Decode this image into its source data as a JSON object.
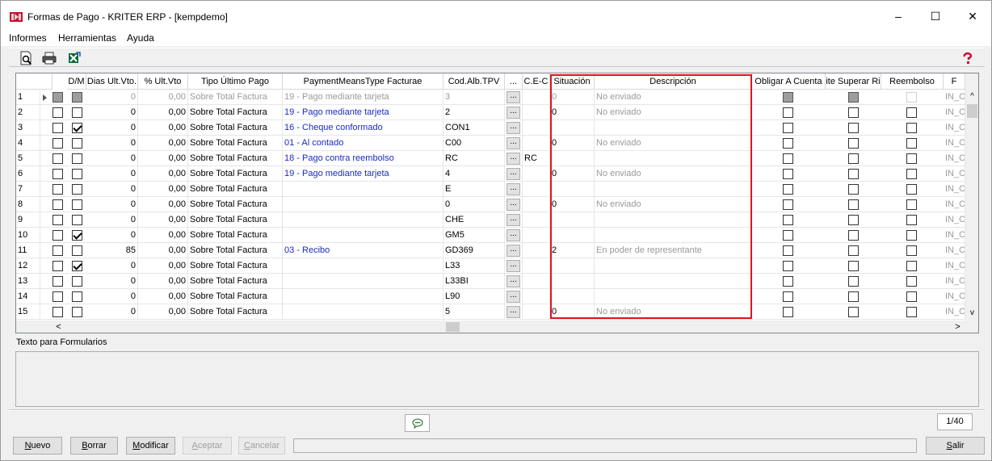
{
  "window": {
    "title": "Formas de Pago - KRITER ERP - [kempdemo]",
    "minimize": "–",
    "maximize": "☐",
    "close": "✕"
  },
  "menu": [
    "Informes",
    "Herramientas",
    "Ayuda"
  ],
  "toolbar": {
    "icons": [
      "print-preview-icon",
      "printer-icon",
      "excel-export-icon",
      "help-icon"
    ]
  },
  "grid": {
    "columns": [
      "",
      "",
      "D/M",
      "Dias Ult.Vto.",
      "% Ult.Vto",
      "Tipo Último Pago",
      "PaymentMeansType Facturae",
      "Cod.Alb.TPV",
      "...",
      "C.E-C",
      "Situación",
      "Descripción",
      "Obligar A Cuenta",
      "ite Superar Ri",
      "Reembolso",
      "F"
    ],
    "rows": [
      {
        "n": "1",
        "cur": true,
        "dm": "ind",
        "dias": "0",
        "pct": "0,00",
        "tipo": "Sobre Total Factura",
        "pm": "19 - Pago mediante tarjeta",
        "cod": "3",
        "cec": "",
        "sit": "0",
        "desc": "No enviado",
        "obl": "ind",
        "sup": "ind",
        "ree": "dis",
        "f": "IN_C",
        "gray": true
      },
      {
        "n": "2",
        "dm": "",
        "dias": "0",
        "pct": "0,00",
        "tipo": "Sobre Total Factura",
        "pm": "19 - Pago mediante tarjeta",
        "cod": "2",
        "cec": "",
        "sit": "0",
        "desc": "No enviado",
        "f": "IN_C"
      },
      {
        "n": "3",
        "dm": "chk",
        "dias": "0",
        "pct": "0,00",
        "tipo": "Sobre Total Factura",
        "pm": "16 - Cheque conformado",
        "cod": "CON1",
        "cec": "",
        "sit": "",
        "desc": "",
        "f": "IN_C"
      },
      {
        "n": "4",
        "dm": "",
        "dias": "0",
        "pct": "0,00",
        "tipo": "Sobre Total Factura",
        "pm": "01 - Al contado",
        "cod": "C00",
        "cec": "",
        "sit": "0",
        "desc": "No enviado",
        "f": "IN_C"
      },
      {
        "n": "5",
        "dm": "",
        "dias": "0",
        "pct": "0,00",
        "tipo": "Sobre Total Factura",
        "pm": "18 - Pago contra reembolso",
        "cod": "RC",
        "cec": "RC",
        "sit": "",
        "desc": "",
        "f": "IN_C"
      },
      {
        "n": "6",
        "dm": "",
        "dias": "0",
        "pct": "0,00",
        "tipo": "Sobre Total Factura",
        "pm": "19 - Pago mediante tarjeta",
        "cod": "4",
        "cec": "",
        "sit": "0",
        "desc": "No enviado",
        "f": "IN_C"
      },
      {
        "n": "7",
        "dm": "",
        "dias": "0",
        "pct": "0,00",
        "tipo": "Sobre Total Factura",
        "pm": "",
        "cod": "E",
        "cec": "",
        "sit": "",
        "desc": "",
        "f": "IN_C"
      },
      {
        "n": "8",
        "dm": "",
        "dias": "0",
        "pct": "0,00",
        "tipo": "Sobre Total Factura",
        "pm": "",
        "cod": "0",
        "cec": "",
        "sit": "0",
        "desc": "No enviado",
        "f": "IN_C"
      },
      {
        "n": "9",
        "dm": "",
        "dias": "0",
        "pct": "0,00",
        "tipo": "Sobre Total Factura",
        "pm": "",
        "cod": "CHE",
        "cec": "",
        "sit": "",
        "desc": "",
        "f": "IN_C"
      },
      {
        "n": "10",
        "dm": "chk",
        "dias": "0",
        "pct": "0,00",
        "tipo": "Sobre Total Factura",
        "pm": "",
        "cod": "GM5",
        "cec": "",
        "sit": "",
        "desc": "",
        "f": "IN_C"
      },
      {
        "n": "11",
        "dm": "",
        "dias": "85",
        "pct": "0,00",
        "tipo": "Sobre Total Factura",
        "pm": "03 - Recibo",
        "cod": "GD369",
        "cec": "",
        "sit": "2",
        "desc": "En poder de representante",
        "f": "IN_C"
      },
      {
        "n": "12",
        "dm": "chk",
        "dias": "0",
        "pct": "0,00",
        "tipo": "Sobre Total Factura",
        "pm": "",
        "cod": "L33",
        "cec": "",
        "sit": "",
        "desc": "",
        "f": "IN_C"
      },
      {
        "n": "13",
        "dm": "",
        "dias": "0",
        "pct": "0,00",
        "tipo": "Sobre Total Factura",
        "pm": "",
        "cod": "L33BI",
        "cec": "",
        "sit": "",
        "desc": "",
        "f": "IN_C"
      },
      {
        "n": "14",
        "dm": "",
        "dias": "0",
        "pct": "0,00",
        "tipo": "Sobre Total Factura",
        "pm": "",
        "cod": "L90",
        "cec": "",
        "sit": "",
        "desc": "",
        "f": "IN_C"
      },
      {
        "n": "15",
        "dm": "",
        "dias": "0",
        "pct": "0,00",
        "tipo": "Sobre Total Factura",
        "pm": "",
        "cod": "5",
        "cec": "",
        "sit": "0",
        "desc": "No enviado",
        "f": "IN_C"
      }
    ],
    "dots_label": "...",
    "scroll": {
      "up": "^",
      "down": "v",
      "left": "<",
      "right": ">"
    }
  },
  "memo": {
    "label": "Texto para Formularios",
    "value": ""
  },
  "counter": "1/40",
  "buttons": {
    "nuevo": "Nuevo",
    "borrar": "Borrar",
    "modificar": "Modificar",
    "aceptar": "Aceptar",
    "cancelar": "Cancelar",
    "salir": "Salir"
  },
  "colors": {
    "highlight_box": "#e0141e",
    "link_text": "#1a2bc0"
  }
}
